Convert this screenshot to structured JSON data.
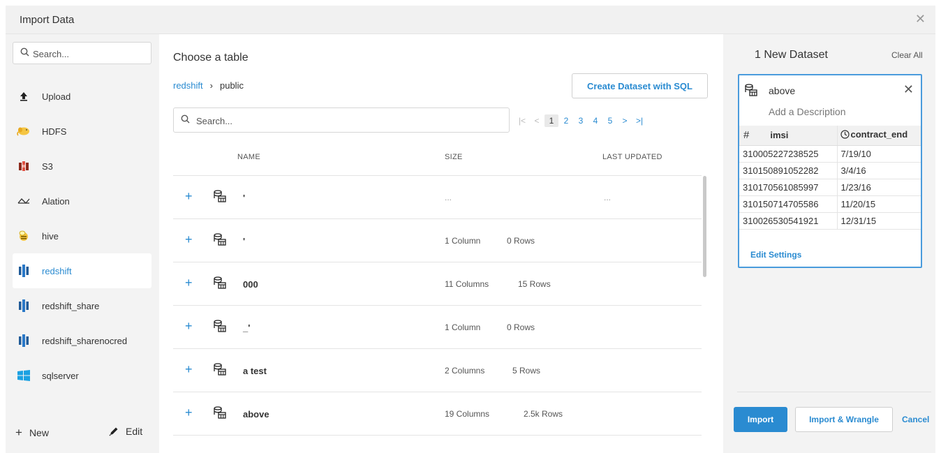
{
  "dialog": {
    "title": "Import Data",
    "close_icon": "close-icon"
  },
  "sidebar": {
    "search_placeholder": "Search...",
    "items": [
      {
        "label": "Upload",
        "icon": "upload-icon",
        "active": false
      },
      {
        "label": "HDFS",
        "icon": "hadoop-elephant-icon",
        "active": false
      },
      {
        "label": "S3",
        "icon": "aws-s3-icon",
        "active": false
      },
      {
        "label": "Alation",
        "icon": "alation-icon",
        "active": false
      },
      {
        "label": "hive",
        "icon": "hive-bee-icon",
        "active": false
      },
      {
        "label": "redshift",
        "icon": "redshift-icon",
        "active": true
      },
      {
        "label": "redshift_share",
        "icon": "redshift-icon",
        "active": false
      },
      {
        "label": "redshift_sharenocred",
        "icon": "redshift-icon",
        "active": false
      },
      {
        "label": "sqlserver",
        "icon": "windows-icon",
        "active": false
      }
    ],
    "new_label": "New",
    "edit_label": "Edit"
  },
  "main": {
    "heading": "Choose a table",
    "breadcrumb": {
      "source": "redshift",
      "schema": "public"
    },
    "sql_button": "Create Dataset with SQL",
    "search_placeholder": "Search...",
    "pager": {
      "first": "|<",
      "prev": "<",
      "pages": [
        "1",
        "2",
        "3",
        "4",
        "5"
      ],
      "current": "1",
      "next": ">",
      "last": ">|"
    },
    "columns": {
      "name": "NAME",
      "size": "SIZE",
      "updated": "LAST UPDATED"
    },
    "rows": [
      {
        "name": "'",
        "cols": "...",
        "rows": "",
        "updated": "..."
      },
      {
        "name": "'",
        "cols": "1 Column",
        "rows": "0 Rows",
        "updated": ""
      },
      {
        "name": "000",
        "cols": "11 Columns",
        "rows": "15 Rows",
        "updated": ""
      },
      {
        "name": "_'",
        "cols": "1 Column",
        "rows": "0 Rows",
        "updated": ""
      },
      {
        "name": "a test",
        "cols": "2 Columns",
        "rows": "5 Rows",
        "updated": ""
      },
      {
        "name": "above",
        "cols": "19 Columns",
        "rows": "2.5k Rows",
        "updated": ""
      }
    ]
  },
  "right": {
    "heading": "1 New Dataset",
    "clear_all": "Clear All",
    "dataset": {
      "name": "above",
      "description_placeholder": "Add a Description",
      "columns": [
        {
          "type_icon": "#",
          "name": "imsi"
        },
        {
          "type_icon": "clock-icon",
          "name": "contract_end"
        }
      ],
      "rows": [
        [
          "310005227238525",
          "7/19/10"
        ],
        [
          "310150891052282",
          "3/4/16"
        ],
        [
          "310170561085997",
          "1/23/16"
        ],
        [
          "310150714705586",
          "11/20/15"
        ],
        [
          "310026530541921",
          "12/31/15"
        ]
      ],
      "edit_settings": "Edit Settings"
    },
    "import_button": "Import",
    "wrangle_button": "Import & Wrangle",
    "cancel_button": "Cancel"
  },
  "colors": {
    "accent": "#2a8bd1",
    "panel": "#f3f3f3",
    "card_border": "#4a9bdc"
  }
}
